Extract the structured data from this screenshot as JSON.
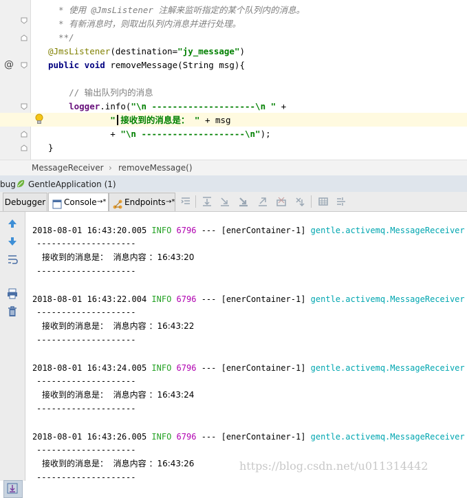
{
  "editor": {
    "lines": [
      {
        "parts": [
          {
            "cls": "cmt-doc",
            "text": "  * 使用 "
          },
          {
            "cls": "cmt-doc",
            "text": "@JmsListener"
          },
          {
            "cls": "cmt-doc",
            "text": " 注解来监听指定的某个队列内的消息。"
          }
        ]
      },
      {
        "parts": [
          {
            "cls": "cmt-doc",
            "text": "  * 有新消息时，则取出队列内消息并进行处理。"
          }
        ]
      },
      {
        "parts": [
          {
            "cls": "cmt-doc",
            "text": "  **/"
          }
        ]
      },
      {
        "parts": [
          {
            "cls": "ann",
            "text": "@JmsListener"
          },
          {
            "cls": "",
            "text": "(destination="
          },
          {
            "cls": "str",
            "text": "\"jy_message\""
          },
          {
            "cls": "",
            "text": ")"
          }
        ]
      },
      {
        "parts": [
          {
            "cls": "kw",
            "text": "public void "
          },
          {
            "cls": "",
            "text": "removeMessage(String msg){"
          }
        ]
      },
      {
        "parts": [
          {
            "cls": "",
            "text": ""
          }
        ]
      },
      {
        "parts": [
          {
            "cls": "cmt",
            "text": "    // 输出队列内的消息"
          }
        ]
      },
      {
        "parts": [
          {
            "cls": "fld",
            "text": "    logger"
          },
          {
            "cls": "",
            "text": ".info("
          },
          {
            "cls": "str",
            "text": "\"\\n --------------------\\n \""
          },
          {
            "cls": "",
            "text": " +"
          }
        ]
      },
      {
        "parts": [
          {
            "cls": "str",
            "text": "            \" 接收到的消息是： \""
          },
          {
            "cls": "",
            "text": " + msg"
          }
        ]
      },
      {
        "parts": [
          {
            "cls": "",
            "text": "            + "
          },
          {
            "cls": "str",
            "text": "\"\\n --------------------\\n\""
          },
          {
            "cls": "",
            "text": ");"
          }
        ]
      },
      {
        "parts": [
          {
            "cls": "",
            "text": ""
          }
        ]
      },
      {
        "parts": [
          {
            "cls": "",
            "text": "}"
          }
        ]
      }
    ],
    "gutter_mark": "@"
  },
  "breadcrumb": {
    "class_name": "MessageReceiver",
    "separator": "›",
    "method_name": "removeMessage()"
  },
  "debug": {
    "title_prefix": "bug",
    "config_name": "GentleApplication (1)"
  },
  "toolbar": {
    "tab_debugger": "Debugger",
    "tab_console": "Console",
    "tab_console_suffix": "→*",
    "tab_endpoints": "Endpoints",
    "tab_endpoints_suffix": "→*"
  },
  "console": {
    "entries": [
      {
        "timestamp": "2018-08-01 16:43:20.005",
        "level": "INFO",
        "pid": "6796",
        "sep": "---",
        "thread": "[enerContainer-1]",
        "logger": "gentle.activemq.MessageReceiver",
        "dash": "--------------------",
        "msg_label": "接收到的消息是：",
        "msg_content": "消息内容 ：16:43:20"
      },
      {
        "timestamp": "2018-08-01 16:43:22.004",
        "level": "INFO",
        "pid": "6796",
        "sep": "---",
        "thread": "[enerContainer-1]",
        "logger": "gentle.activemq.MessageReceiver",
        "dash": "--------------------",
        "msg_label": "接收到的消息是：",
        "msg_content": "消息内容 ：16:43:22"
      },
      {
        "timestamp": "2018-08-01 16:43:24.005",
        "level": "INFO",
        "pid": "6796",
        "sep": "---",
        "thread": "[enerContainer-1]",
        "logger": "gentle.activemq.MessageReceiver",
        "dash": "--------------------",
        "msg_label": "接收到的消息是：",
        "msg_content": "消息内容 ：16:43:24"
      },
      {
        "timestamp": "2018-08-01 16:43:26.005",
        "level": "INFO",
        "pid": "6796",
        "sep": "---",
        "thread": "[enerContainer-1]",
        "logger": "gentle.activemq.MessageReceiver",
        "dash": "--------------------",
        "msg_label": "接收到的消息是：",
        "msg_content": "消息内容 ：16:43:26"
      }
    ]
  },
  "watermark": "https://blog.csdn.net/u011314442",
  "colors": {
    "keyword": "#000080",
    "string": "#008000",
    "annotation": "#808000",
    "comment": "#808080",
    "log_level": "#23a123",
    "pid": "#b000b0",
    "logger": "#00a6b0",
    "highlight_line": "#fffae0"
  }
}
